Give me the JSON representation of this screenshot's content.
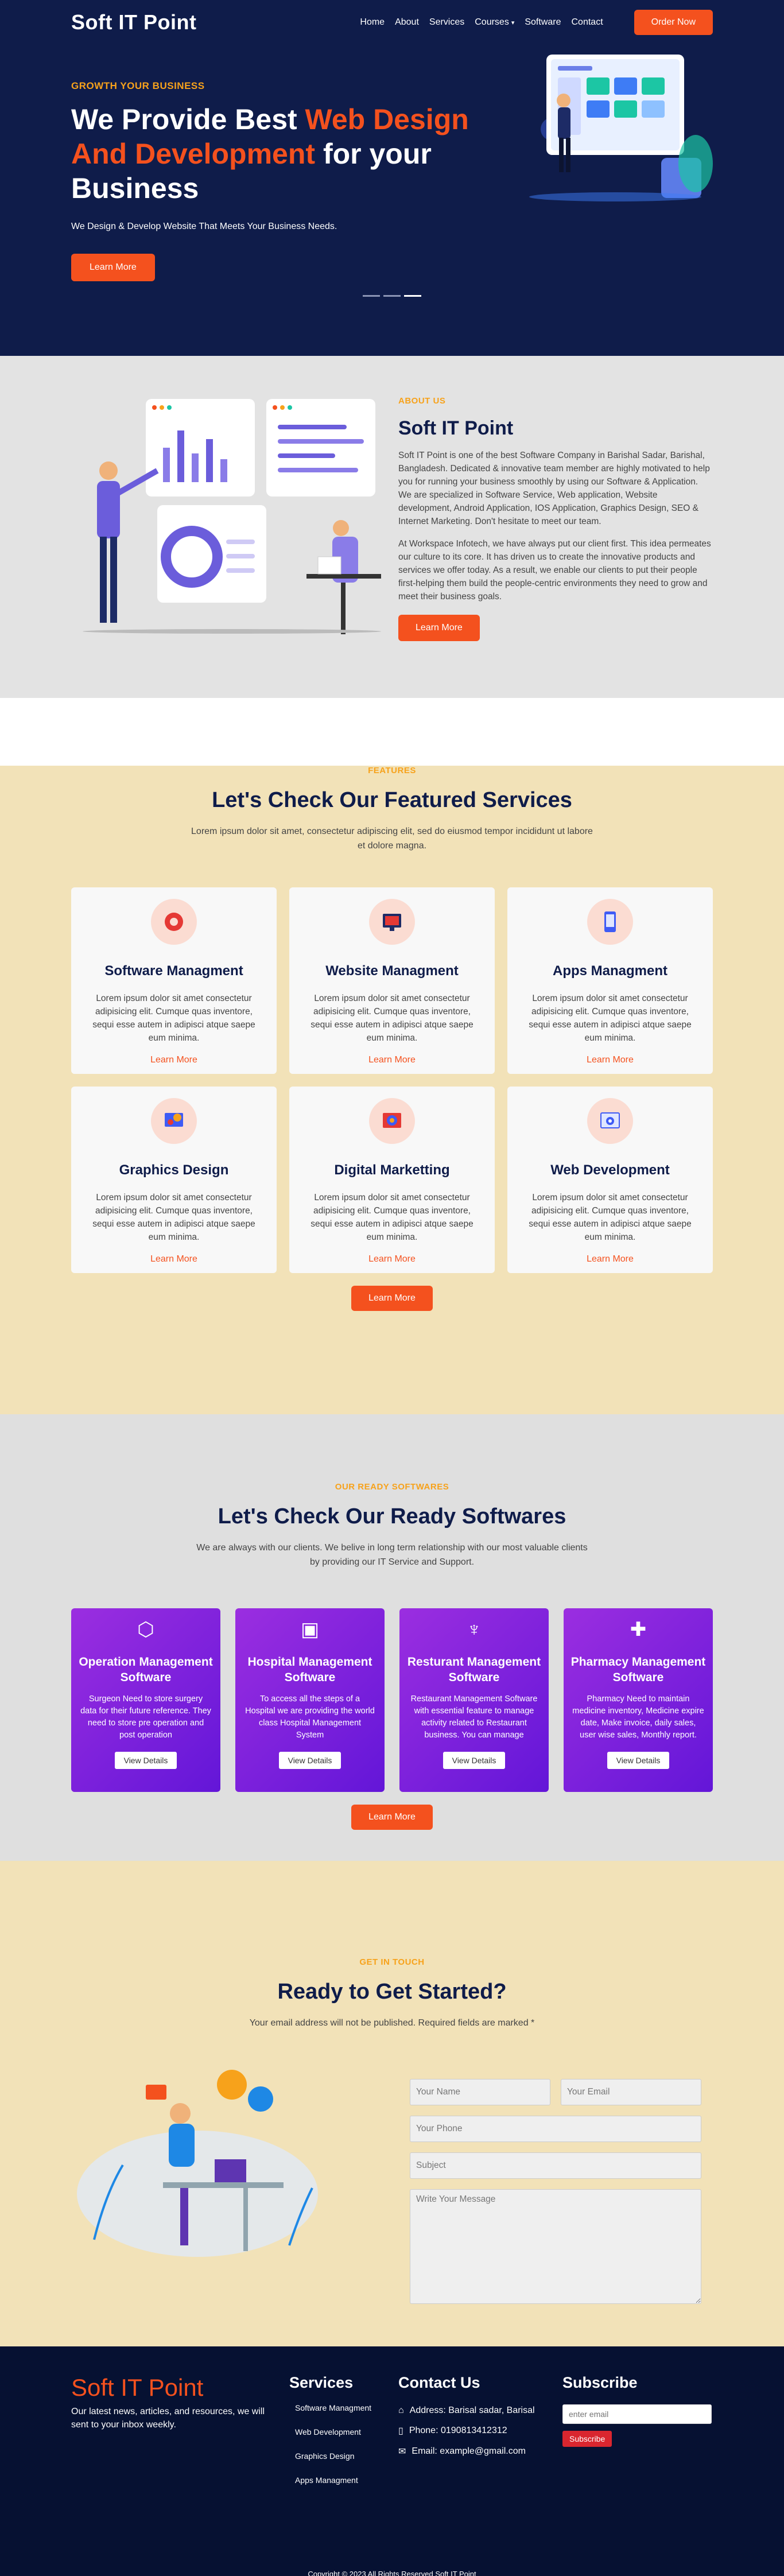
{
  "nav": {
    "logo": "Soft IT Point",
    "items": [
      "Home",
      "About",
      "Services",
      "Courses",
      "Software",
      "Contact"
    ],
    "courses_caret": "▾",
    "order": "Order Now"
  },
  "hero": {
    "eyebrow": "GROWTH YOUR BUSINESS",
    "title_a": "We Provide Best ",
    "title_b": "Web Design And Development",
    "title_c": " for your Business",
    "sub": "We Design & Develop Website That Meets Your Business Needs.",
    "btn": "Learn More",
    "slides": 3,
    "active_slide": 2
  },
  "about": {
    "label": "ABOUT US",
    "title": "Soft IT Point",
    "p1": "Soft IT Point is one of the best Software Company in Barishal Sadar, Barishal, Bangladesh. Dedicated & innovative team member are highly motivated to help you for running your business smoothly by using our Software & Application. We are specialized in Software Service, Web application, Website development, Android Application, IOS Application, Graphics Design, SEO & Internet Marketing. Don't hesitate to meet our team.",
    "p2": "At Workspace Infotech, we have always put our client first. This idea permeates our culture to its core. It has driven us to create the innovative products and services we offer today. As a result, we enable our clients to put their people first-helping them build the people-centric environments they need to grow and meet their business goals.",
    "btn": "Learn More"
  },
  "features": {
    "label": "FEATURES",
    "title": "Let's Check Our Featured Services",
    "desc": "Lorem ipsum dolor sit amet, consectetur adipiscing elit, sed do eiusmod tempor incididunt ut labore et dolore magna.",
    "cards": [
      {
        "title": "Software Managment",
        "icon": "software-gear-icon",
        "text": "Lorem ipsum dolor sit amet consectetur adipisicing elit. Cumque quas inventore, sequi esse autem in adipisci atque saepe eum minima.",
        "link": "Learn More"
      },
      {
        "title": "Website Managment",
        "icon": "website-monitor-icon",
        "text": "Lorem ipsum dolor sit amet consectetur adipisicing elit. Cumque quas inventore, sequi esse autem in adipisci atque saepe eum minima.",
        "link": "Learn More"
      },
      {
        "title": "Apps Managment",
        "icon": "mobile-app-icon",
        "text": "Lorem ipsum dolor sit amet consectetur adipisicing elit. Cumque quas inventore, sequi esse autem in adipisci atque saepe eum minima.",
        "link": "Learn More"
      },
      {
        "title": "Graphics Design",
        "icon": "design-palette-icon",
        "text": "Lorem ipsum dolor sit amet consectetur adipisicing elit. Cumque quas inventore, sequi esse autem in adipisci atque saepe eum minima.",
        "link": "Learn More"
      },
      {
        "title": "Digital Marketting",
        "icon": "marketing-icon",
        "text": "Lorem ipsum dolor sit amet consectetur adipisicing elit. Cumque quas inventore, sequi esse autem in adipisci atque saepe eum minima.",
        "link": "Learn More"
      },
      {
        "title": "Web Development",
        "icon": "web-dev-icon",
        "text": "Lorem ipsum dolor sit amet consectetur adipisicing elit. Cumque quas inventore, sequi esse autem in adipisci atque saepe eum minima.",
        "link": "Learn More"
      }
    ],
    "btn": "Learn More"
  },
  "software": {
    "label": "OUR READY SOFTWARES",
    "title": "Let's Check Our Ready Softwares",
    "desc": "We are always with our clients. We belive in long term relationship with our most valuable clients by providing our IT Service and Support.",
    "cards": [
      {
        "title": "Operation Management Software",
        "icon": "box-icon",
        "text": "Surgeon Need to store surgery data for their future reference. They need to store pre operation and post operation",
        "btn": "View Details"
      },
      {
        "title": "Hospital Management Software",
        "icon": "hospital-icon",
        "text": "To access all the steps of a Hospital we are providing the world class Hospital Management System",
        "btn": "View Details"
      },
      {
        "title": "Resturant Management Software",
        "icon": "fork-knife-icon",
        "text": "Restaurant Management Software with essential feature to manage activity related to Restaurant business. You can manage",
        "btn": "View Details"
      },
      {
        "title": "Pharmacy Management Software",
        "icon": "medicine-bottle-icon",
        "text": "Pharmacy Need to maintain medicine inventory, Medicine expire date, Make invoice, daily sales, user wise sales, Monthly report.",
        "btn": "View Details"
      }
    ],
    "btn": "Learn More"
  },
  "contact": {
    "label": "GET IN TOUCH",
    "title": "Ready to Get Started?",
    "desc": "Your email address will not be published. Required fields are marked *",
    "name": "Your Name",
    "email": "Your Email",
    "phone": "Your Phone",
    "subject": "Subject",
    "message": "Write Your Message"
  },
  "footer": {
    "logo": "Soft IT Point",
    "tag": "Our latest news, articles, and resources, we will sent to your inbox weekly.",
    "services_h": "Services",
    "services": [
      "Software Managment",
      "Web Development",
      "Graphics Design",
      "Apps Managment"
    ],
    "contact_h": "Contact Us",
    "address": "Address: Barisal sadar, Barisal",
    "phone": "Phone: 0190813412312",
    "mail": "Email: example@gmail.com",
    "subscribe_h": "Subscribe",
    "email_ph": "enter email",
    "subscribe_btn": "Subscribe",
    "copyright": "Copyright © 2023 All Rights Reserved Soft IT Point"
  },
  "colors": {
    "navy": "#0f1c4a",
    "orange": "#f4511e",
    "gold": "#f7a21b",
    "purple": "#7b1fe0",
    "cream": "#f2e2b8"
  }
}
